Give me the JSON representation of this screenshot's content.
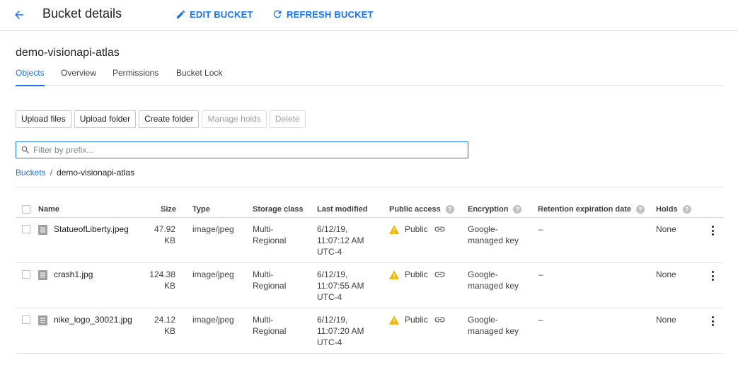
{
  "header": {
    "title": "Bucket details",
    "edit_label": "EDIT BUCKET",
    "refresh_label": "REFRESH BUCKET"
  },
  "bucket": {
    "name": "demo-visionapi-atlas"
  },
  "tabs": [
    {
      "label": "Objects",
      "active": true
    },
    {
      "label": "Overview",
      "active": false
    },
    {
      "label": "Permissions",
      "active": false
    },
    {
      "label": "Bucket Lock",
      "active": false
    }
  ],
  "toolbar": {
    "upload_files": "Upload files",
    "upload_folder": "Upload folder",
    "create_folder": "Create folder",
    "manage_holds": "Manage holds",
    "delete": "Delete"
  },
  "filter": {
    "placeholder": "Filter by prefix..."
  },
  "breadcrumb": {
    "root": "Buckets",
    "separator": "/",
    "current": "demo-visionapi-atlas"
  },
  "table": {
    "columns": {
      "name": "Name",
      "size": "Size",
      "type": "Type",
      "storage": "Storage class",
      "modified": "Last modified",
      "access": "Public access",
      "encryption": "Encryption",
      "retention": "Retention expiration date",
      "holds": "Holds"
    },
    "rows": [
      {
        "name": "StatueofLiberty.jpeg",
        "size_num": "47.92",
        "size_unit": "KB",
        "type": "image/jpeg",
        "storage_1": "Multi-",
        "storage_2": "Regional",
        "modified_1": "6/12/19,",
        "modified_2": "11:07:12 AM",
        "modified_3": "UTC-4",
        "access": "Public",
        "enc_1": "Google-",
        "enc_2": "managed key",
        "retention": "–",
        "holds": "None"
      },
      {
        "name": "crash1.jpg",
        "size_num": "124.38",
        "size_unit": "KB",
        "type": "image/jpeg",
        "storage_1": "Multi-",
        "storage_2": "Regional",
        "modified_1": "6/12/19,",
        "modified_2": "11:07:55 AM",
        "modified_3": "UTC-4",
        "access": "Public",
        "enc_1": "Google-",
        "enc_2": "managed key",
        "retention": "–",
        "holds": "None"
      },
      {
        "name": "nike_logo_30021.jpg",
        "size_num": "24.12",
        "size_unit": "KB",
        "type": "image/jpeg",
        "storage_1": "Multi-",
        "storage_2": "Regional",
        "modified_1": "6/12/19,",
        "modified_2": "11:07:20 AM",
        "modified_3": "UTC-4",
        "access": "Public",
        "enc_1": "Google-",
        "enc_2": "managed key",
        "retention": "–",
        "holds": "None"
      }
    ]
  },
  "colors": {
    "accent": "#1a73e8",
    "warning": "#f4b400",
    "divider": "#dadce0"
  },
  "icons": {
    "back": "arrow-back-icon",
    "edit": "pencil-icon",
    "refresh": "refresh-icon",
    "search": "search-icon",
    "file": "file-icon",
    "warning": "warning-icon",
    "link": "link-icon",
    "help": "help-icon",
    "more": "more-vert-icon"
  }
}
